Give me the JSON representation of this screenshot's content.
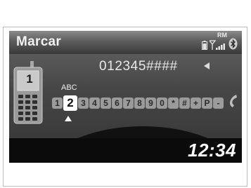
{
  "header": {
    "title": "Marcar",
    "roaming_label": "RM",
    "icons": [
      "battery-icon",
      "signal-icon",
      "bluetooth-icon"
    ]
  },
  "dialer": {
    "number": "012345####",
    "letters_hint": "ABC",
    "selected_key": "2",
    "keys": [
      "1",
      "2",
      "3",
      "4",
      "5",
      "6",
      "7",
      "8",
      "9",
      "0",
      "*",
      "#",
      "+",
      "P",
      "-"
    ],
    "phone_line": "1"
  },
  "footer": {
    "time": "12:34"
  }
}
